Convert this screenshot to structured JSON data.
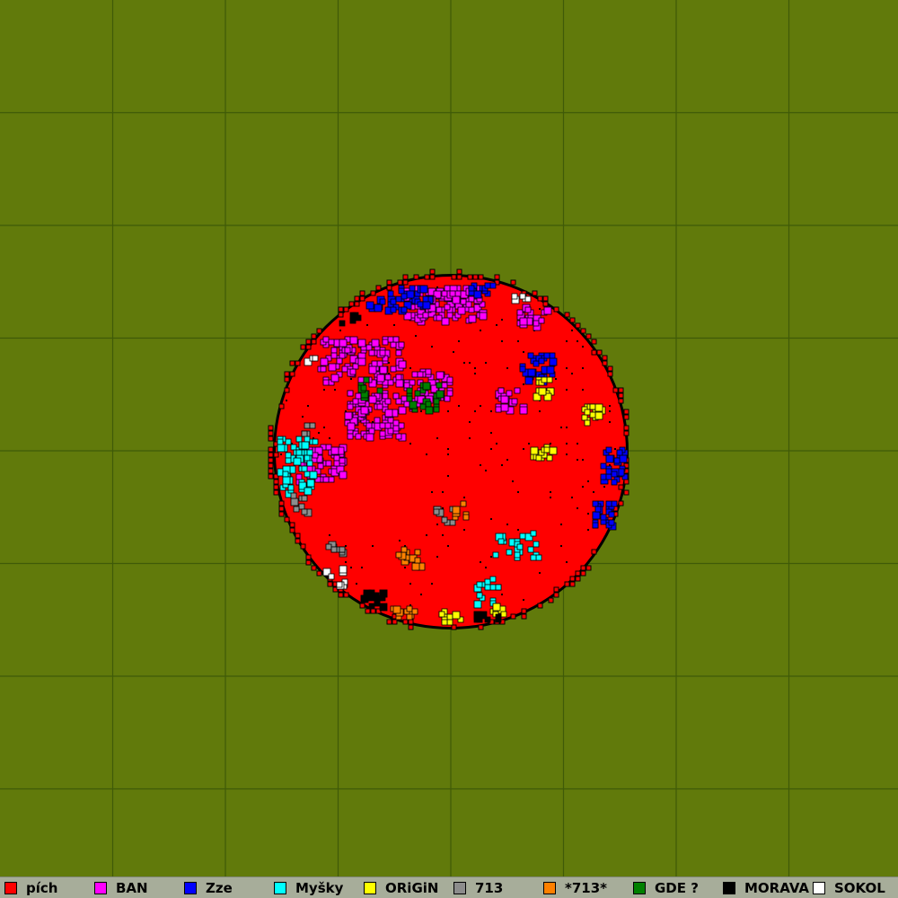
{
  "map": {
    "background_color": "#617a0b",
    "grid_color": "#3f5a08",
    "territory_base_color": "#ff0000",
    "cell_outline_color": "#000000"
  },
  "legend": {
    "items": [
      {
        "label": "pích",
        "color": "#ff0000"
      },
      {
        "label": "BAN",
        "color": "#ff00ff"
      },
      {
        "label": "Zze",
        "color": "#0000ff"
      },
      {
        "label": "Myšky",
        "color": "#00ffff"
      },
      {
        "label": "ORiGiN",
        "color": "#ffff00"
      },
      {
        "label": "713",
        "color": "#8c8c8c"
      },
      {
        "label": "*713*",
        "color": "#ff8000"
      },
      {
        "label": "GDE ?",
        "color": "#008000"
      },
      {
        "label": "MORAVA",
        "color": "#000000"
      },
      {
        "label": "SOKOL",
        "color": "#ffffff"
      }
    ]
  }
}
